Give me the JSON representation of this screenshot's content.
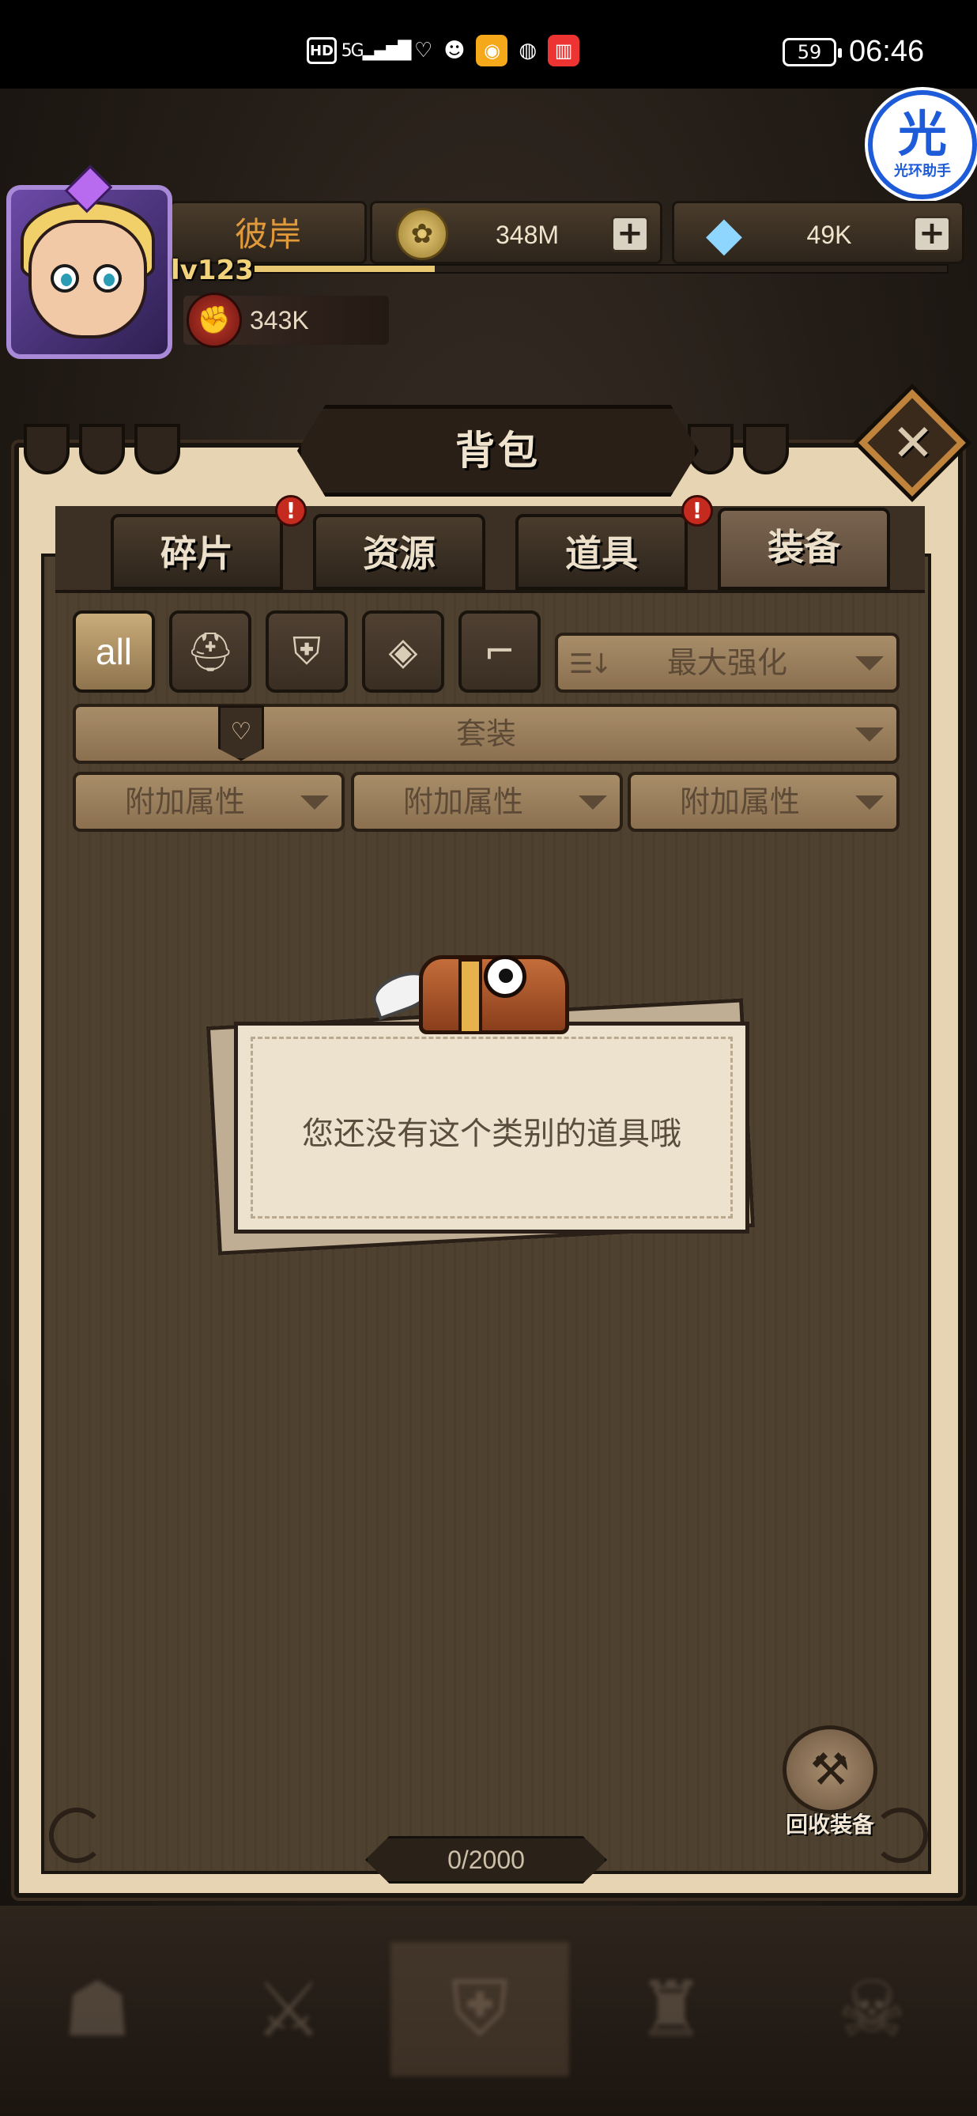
{
  "status_bar": {
    "hd": "HD",
    "signal": "5G",
    "battery": "59",
    "time": "06:46"
  },
  "assistant": {
    "glyph": "光",
    "label": "光环助手"
  },
  "player": {
    "name": "彼岸",
    "level": "lv123",
    "xp_progress": 0.26,
    "power": "343K"
  },
  "currencies": {
    "gold": "348M",
    "gems": "49K"
  },
  "panel": {
    "title": "背包",
    "tabs": [
      {
        "label": "碎片",
        "alert": true
      },
      {
        "label": "资源",
        "alert": false
      },
      {
        "label": "道具",
        "alert": true
      },
      {
        "label": "装备",
        "alert": false,
        "active": true
      }
    ],
    "alert_glyph": "!",
    "filters": {
      "all_label": "all",
      "sort_label": "最大强化",
      "set_label": "套装",
      "attr_labels": [
        "附加属性",
        "附加属性",
        "附加属性"
      ]
    },
    "empty_message": "您还没有这个类别的道具哦",
    "recycle_label": "回收装备",
    "capacity": "0/2000"
  }
}
